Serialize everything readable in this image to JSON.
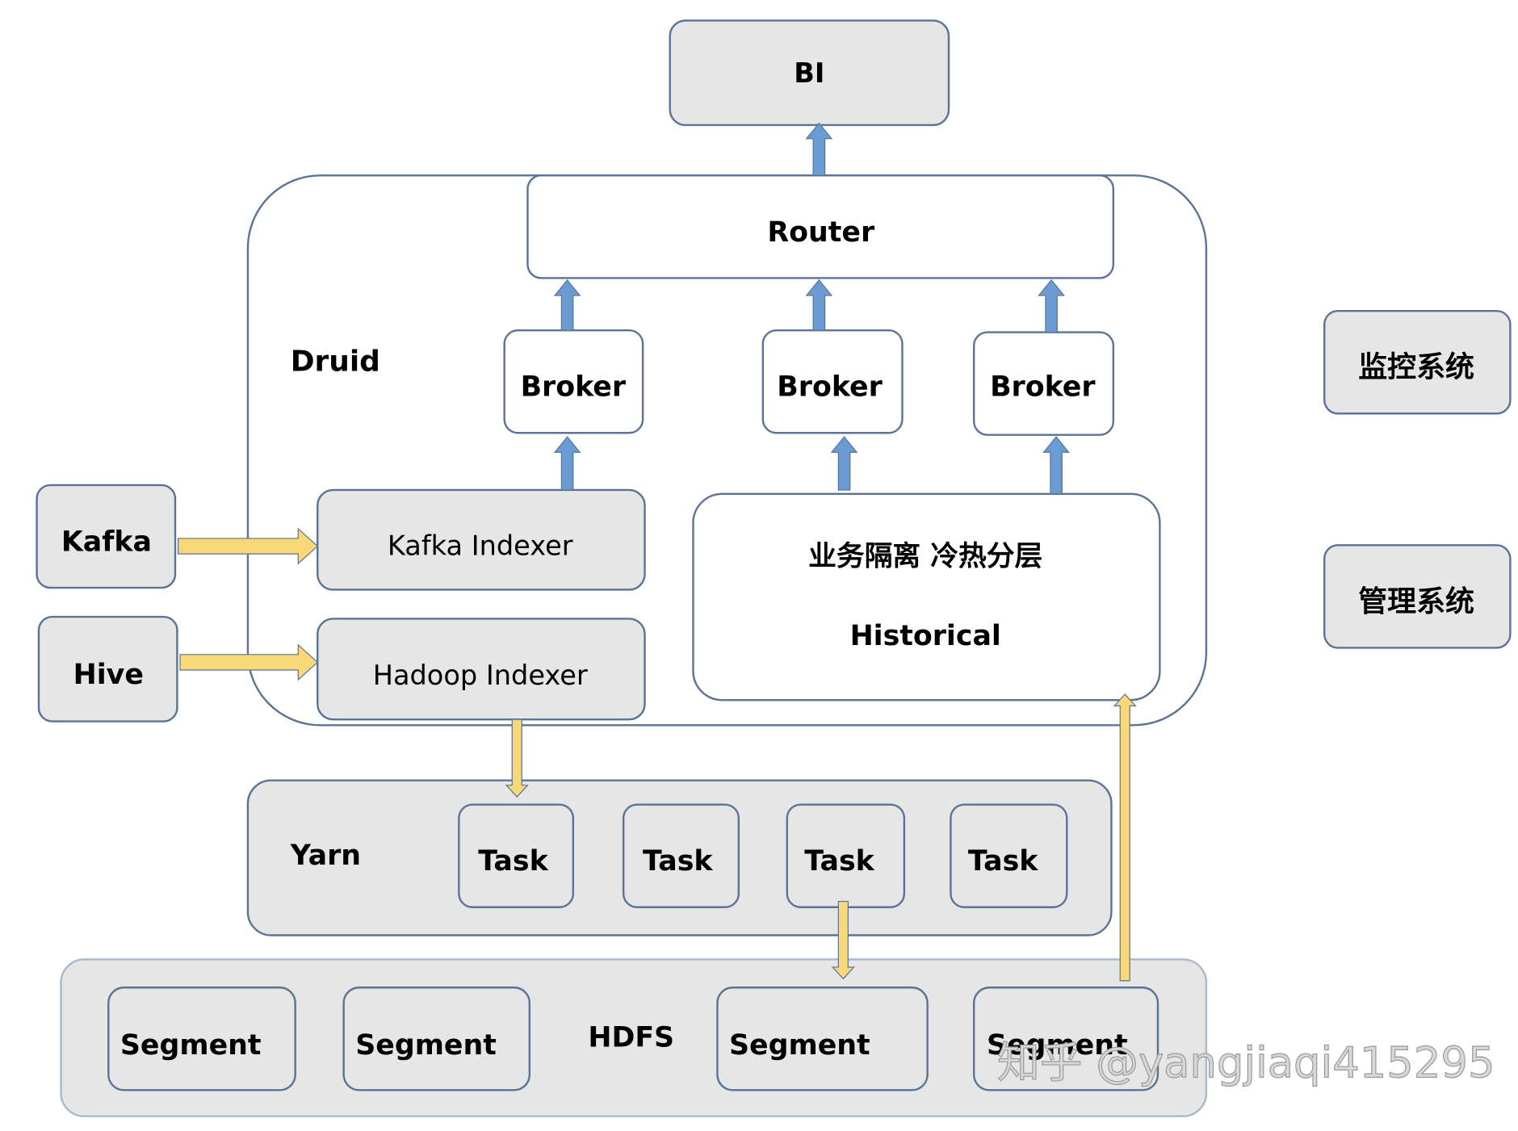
{
  "nodes": {
    "bi": "BI",
    "druid": "Druid",
    "router": "Router",
    "brokers": [
      "Broker",
      "Broker",
      "Broker"
    ],
    "kafka_indexer": "Kafka Indexer",
    "hadoop_indexer": "Hadoop Indexer",
    "historical_title": "业务隔离 冷热分层",
    "historical": "Historical",
    "kafka": "Kafka",
    "hive": "Hive",
    "monitoring": "监控系统",
    "management": "管理系统",
    "yarn": "Yarn",
    "tasks": [
      "Task",
      "Task",
      "Task",
      "Task"
    ],
    "hdfs": "HDFS",
    "segments": [
      "Segment",
      "Segment",
      "Segment",
      "Segment"
    ]
  },
  "watermark": "知乎 @yangjiaqi415295",
  "colors": {
    "blue_arrow": "#6a9bd3",
    "yellow_arrow": "#f9d877",
    "box_fill": "#e6e6e6",
    "box_stroke": "#5a7396"
  }
}
